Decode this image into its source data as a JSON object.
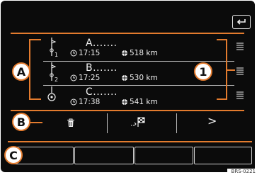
{
  "stops": [
    {
      "name": "A.......",
      "time": "17:15",
      "distance": "518 km",
      "index": "1"
    },
    {
      "name": "B.......",
      "time": "17:25",
      "distance": "530 km",
      "index": "2"
    },
    {
      "name": "C.......",
      "time": "17:38",
      "distance": "541 km",
      "index": ""
    }
  ],
  "icons": {
    "back": "back-arrow-icon",
    "clock": "clock-icon",
    "distance": "globe-icon",
    "waypoint": "waypoint-flag-icon",
    "destination": "destination-pin-icon",
    "drag": "drag-handle-icon",
    "delete": "trash-icon",
    "route": "route-flag-icon",
    "next": "chevron-right-icon"
  },
  "actions": {
    "next_label": ">"
  },
  "callouts": {
    "A": "A",
    "B": "B",
    "C": "C",
    "one": "1"
  },
  "credit": "BRS-0221",
  "colors": {
    "screen_bg": "#0b0b0b",
    "accent_orange": "#e37b2e",
    "text": "#f2f2f2",
    "divider": "#bdbdbd"
  }
}
